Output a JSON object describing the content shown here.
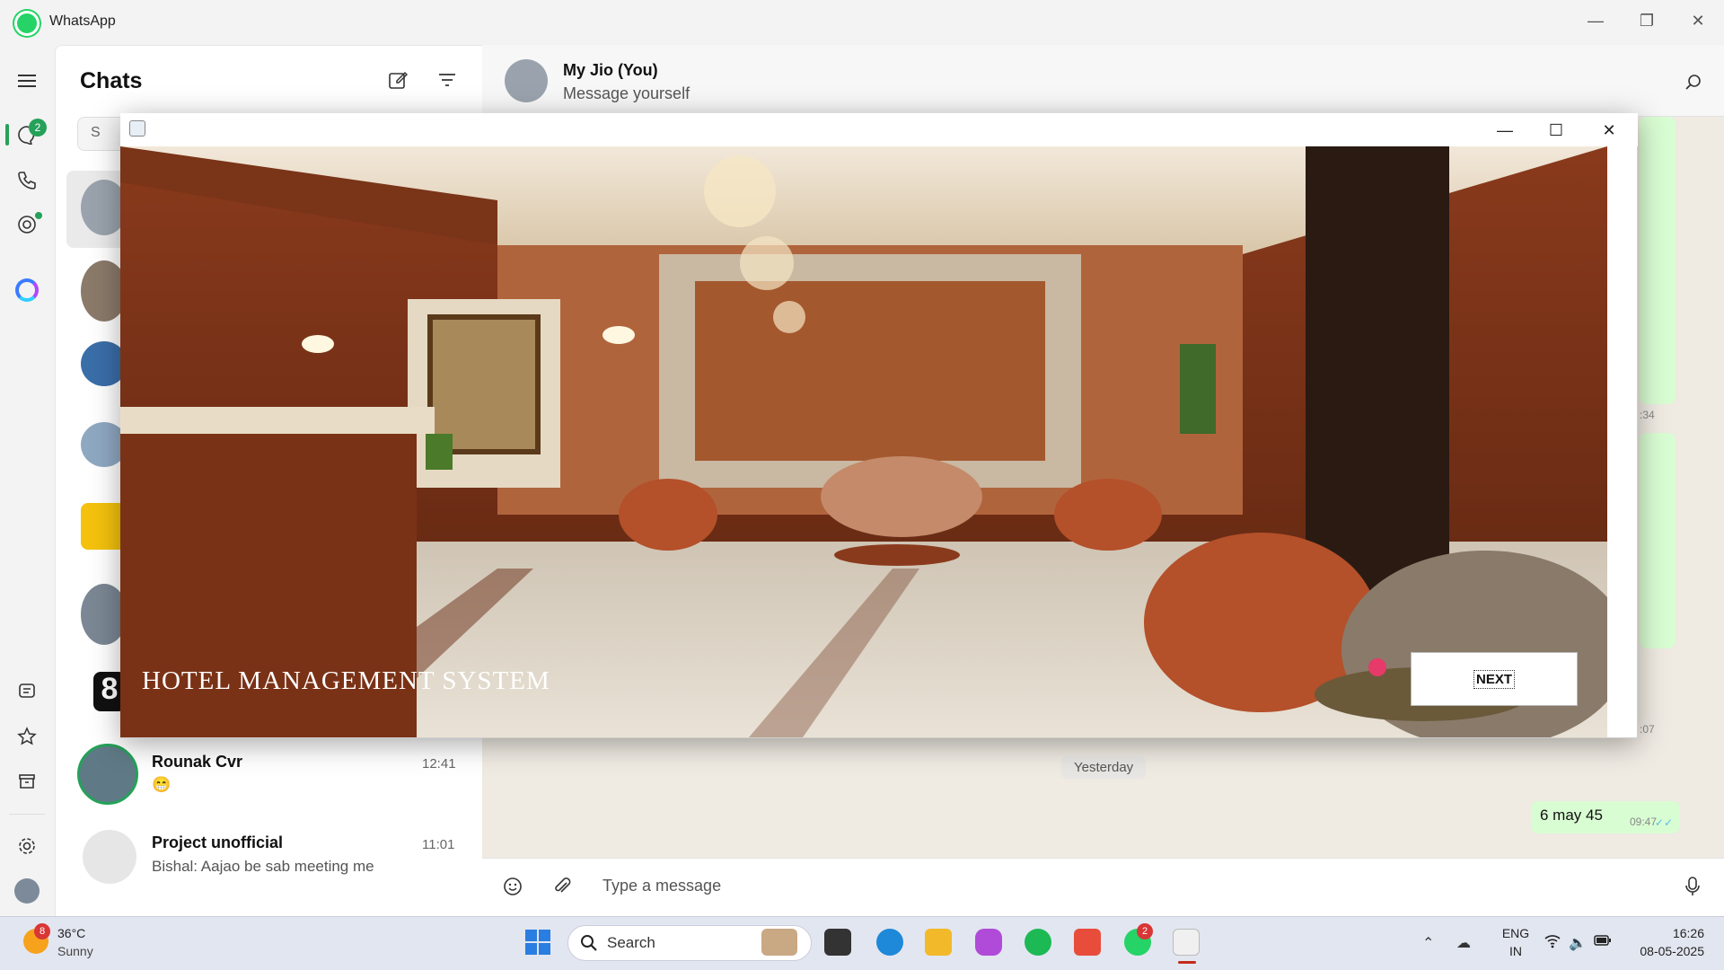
{
  "window": {
    "app_title": "WhatsApp",
    "minimize": "—",
    "restore": "❐",
    "close": "✕"
  },
  "rail": {
    "chats_badge": "2"
  },
  "chatlist": {
    "title": "Chats",
    "search_placeholder": "S",
    "rows": [
      {
        "name": "Rounak Cvr",
        "time": "12:41",
        "preview": "😁"
      },
      {
        "name": "Project unofficial",
        "time": "11:01",
        "preview": "Bishal: Aajao be sab meeting me"
      }
    ],
    "partial_avatar_text": "8"
  },
  "conversation": {
    "name": "My Jio (You)",
    "subtitle": "Message yourself",
    "date_chip": "Yesterday",
    "message": {
      "text": "6 may 45",
      "time": "09:47",
      "ticks": "✓✓"
    },
    "peek_times": [
      ":34",
      ":07"
    ],
    "composer_placeholder": "Type a message"
  },
  "hotel_app": {
    "title": "HOTEL MANAGEMENT SYSTEM",
    "next_label": "NEXT",
    "min": "—",
    "max": "☐",
    "close": "✕"
  },
  "taskbar": {
    "weather_badge": "8",
    "temperature": "36°C",
    "condition": "Sunny",
    "search_label": "Search",
    "whatsapp_badge": "2",
    "lang": "ENG",
    "region": "IN",
    "time": "16:26",
    "date": "08-05-2025"
  }
}
